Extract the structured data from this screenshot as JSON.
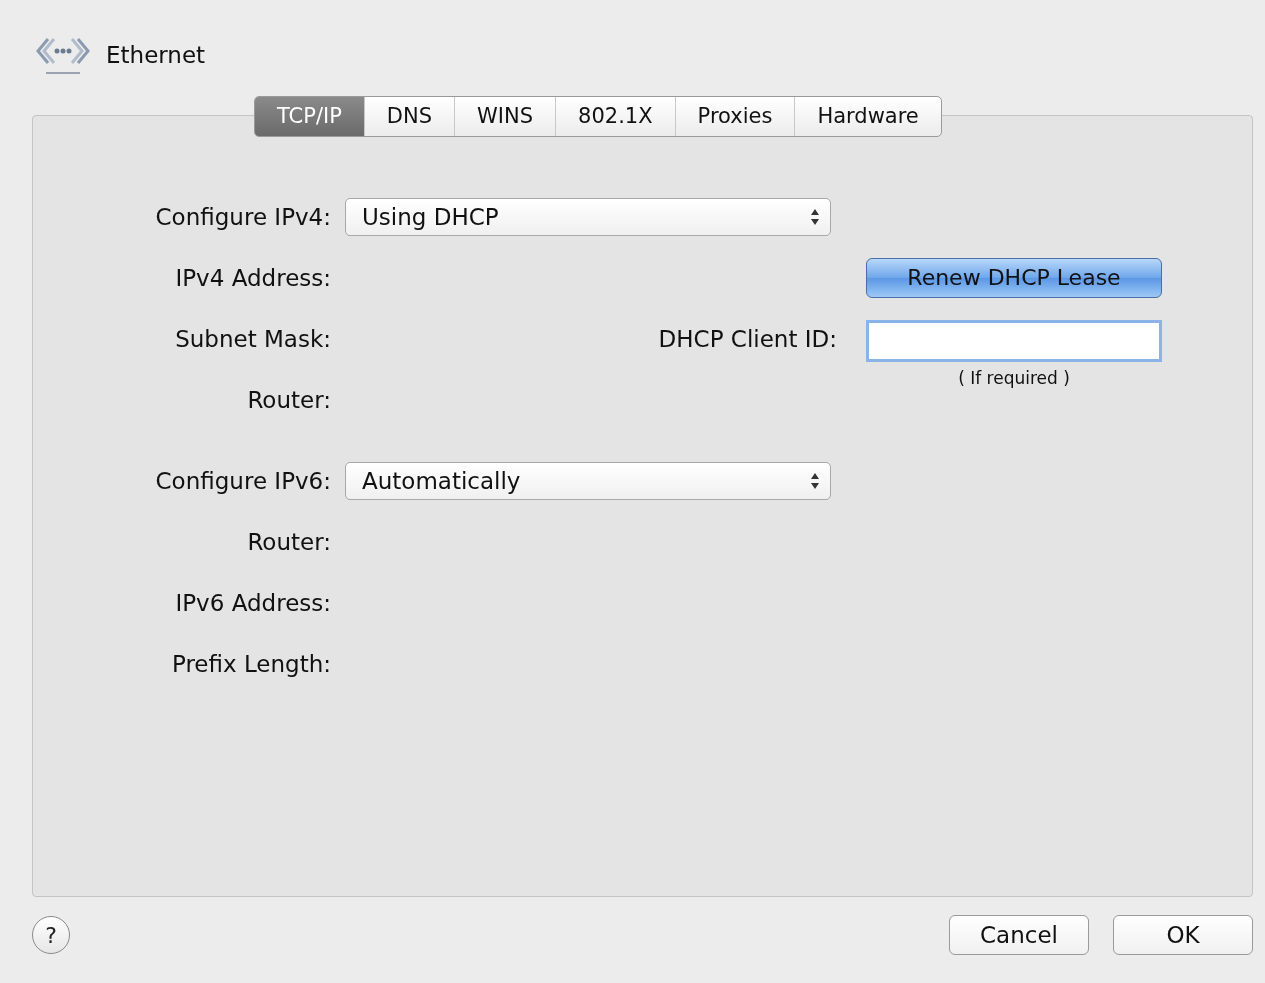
{
  "header": {
    "title": "Ethernet"
  },
  "tabs": [
    {
      "label": "TCP/IP",
      "selected": true
    },
    {
      "label": "DNS",
      "selected": false
    },
    {
      "label": "WINS",
      "selected": false
    },
    {
      "label": "802.1X",
      "selected": false
    },
    {
      "label": "Proxies",
      "selected": false
    },
    {
      "label": "Hardware",
      "selected": false
    }
  ],
  "sections": [
    {
      "rows": [
        {
          "kind": "popup",
          "label": "Configure IPv4:",
          "value": "Using DHCP"
        },
        {
          "kind": "static",
          "label": "IPv4 Address:",
          "aside": {
            "kind": "button",
            "label": "Renew DHCP Lease"
          }
        },
        {
          "kind": "static",
          "label": "Subnet Mask:",
          "aside": {
            "kind": "field",
            "label": "DHCP Client ID:",
            "note": "( If required )"
          }
        },
        {
          "kind": "static",
          "label": "Router:"
        }
      ]
    },
    {
      "rows": [
        {
          "kind": "popup",
          "label": "Configure IPv6:",
          "value": "Automatically"
        },
        {
          "kind": "static",
          "label": "Router:"
        },
        {
          "kind": "static",
          "label": "IPv6 Address:"
        },
        {
          "kind": "static",
          "label": "Prefix Length:"
        }
      ]
    }
  ],
  "footer": {
    "help": "?",
    "buttons": [
      "Cancel",
      "OK"
    ]
  }
}
